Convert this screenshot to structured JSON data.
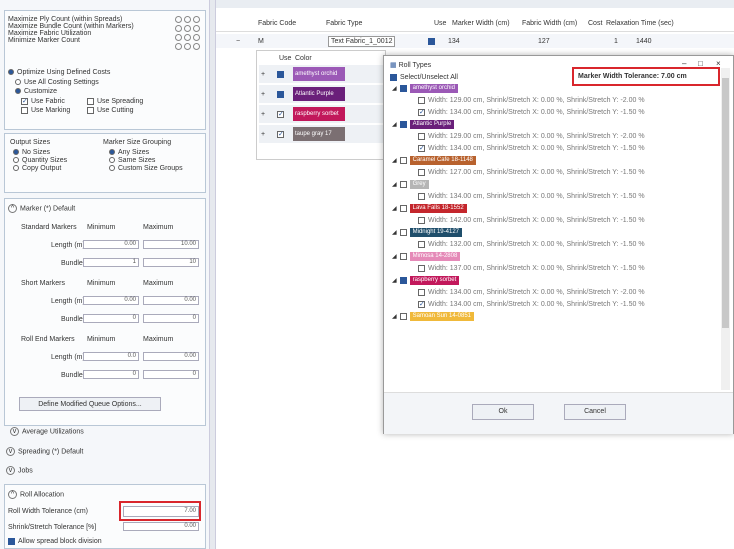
{
  "colors": {
    "accent": "#2b579a",
    "highlight_border": "#d9262c",
    "panel_border": "#b9c7d6"
  },
  "left": {
    "counts": [
      "Maximize Ply Count (within Spreads)",
      "Maximize Bundle Count (within Markers)",
      "Maximize Fabric Utilization",
      "Minimize Marker Count"
    ],
    "optimize": "Optimize Using Defined Costs",
    "use_all_costing": "Use All Costing Settings",
    "customize": "Customize",
    "use_fabric": "Use Fabric",
    "use_spreading": "Use Spreading",
    "use_marking": "Use Marking",
    "use_cutting": "Use Cutting",
    "output_sizes": "Output Sizes",
    "no_sizes": "No Sizes",
    "quantity_sizes": "Quantity Sizes",
    "copy_output": "Copy Output",
    "marker_grouping": "Marker Size Grouping",
    "any_sizes": "Any Sizes",
    "same_sizes": "Same Sizes",
    "custom_groups": "Custom Size Groups",
    "marker_header": "Marker (*) Default",
    "standard_markers": "Standard Markers",
    "minimum": "Minimum",
    "maximum": "Maximum",
    "length": "Length (m)",
    "bundles": "Bundles",
    "std_len_min": "0.00",
    "std_len_max": "10.00",
    "std_bun_min": "1",
    "std_bun_max": "10",
    "short_markers": "Short Markers",
    "short_len_min": "0.00",
    "short_len_max": "0.00",
    "short_bun_min": "0",
    "short_bun_max": "0",
    "roll_end": "Roll End Markers",
    "re_len_min": "0.0",
    "re_len_max": "0.00",
    "re_bun_min": "0",
    "re_bun_max": "0",
    "define_btn": "Define Modified Queue Options...",
    "avg_util": "Average Utilizations",
    "spreading": "Spreading (*) Default",
    "jobs": "Jobs",
    "roll_alloc": "Roll Allocation",
    "roll_width_tol": "Roll Width Tolerance (cm)",
    "roll_width_val": "7.00",
    "shrink_tol": "Shrink/Stretch Tolerance [%]",
    "shrink_val": "0.00",
    "allow_spread": "Allow spread block division"
  },
  "grid": {
    "headers": [
      "Fabric Code",
      "Fabric Type",
      "Use",
      "Marker Width (cm)",
      "Fabric Width (cm)",
      "Cost",
      "Relaxation Time (sec)"
    ],
    "row_code": "M",
    "row_type": "Text Fabric_1_0012",
    "row_width": "134",
    "row_fabric": "127",
    "row_cost": "1",
    "row_relax": "1440",
    "sub_headers": [
      "Use",
      "Color"
    ],
    "colors": [
      {
        "label": "amethyst orchid",
        "color": "#9b59b6"
      },
      {
        "label": "Atlantic Purple",
        "color": "#6a1f7a"
      },
      {
        "label": "raspberry sorbet",
        "color": "#c2185b"
      },
      {
        "label": "taupe gray 17",
        "color": "#7b6f72"
      }
    ]
  },
  "dialog": {
    "title": "Roll Types",
    "select_all": "Select/Unselect All",
    "tolerance": "Marker Width Tolerance: 7.00 cm",
    "ok": "Ok",
    "cancel": "Cancel",
    "groups": [
      {
        "label": "amethyst orchid",
        "color": "#9b59b6",
        "state": "on",
        "rows": [
          {
            "text": "Width: 129.00 cm, Shrink/Stretch X: 0.00 %, Shrink/Stretch Y: -2.00 %",
            "on": false
          },
          {
            "text": "Width: 134.00 cm, Shrink/Stretch X: 0.00 %, Shrink/Stretch Y: -1.50 %",
            "on": true
          }
        ]
      },
      {
        "label": "Atlantic Purple",
        "color": "#6a1f7a",
        "state": "on",
        "rows": [
          {
            "text": "Width: 129.00 cm, Shrink/Stretch X: 0.00 %, Shrink/Stretch Y: -2.00 %",
            "on": false
          },
          {
            "text": "Width: 134.00 cm, Shrink/Stretch X: 0.00 %, Shrink/Stretch Y: -1.50 %",
            "on": true
          }
        ]
      },
      {
        "label": "Caramel Cafe 18-1148",
        "color": "#b8622e",
        "state": "off",
        "rows": [
          {
            "text": "Width: 127.00 cm, Shrink/Stretch X: 0.00 %, Shrink/Stretch Y: -1.50 %",
            "on": false
          }
        ]
      },
      {
        "label": "Grey",
        "color": "#b5b5b5",
        "state": "off",
        "rows": [
          {
            "text": "Width: 134.00 cm, Shrink/Stretch X: 0.00 %, Shrink/Stretch Y: -1.50 %",
            "on": false
          }
        ]
      },
      {
        "label": "Lava Falls 18-1552",
        "color": "#c4262c",
        "state": "off",
        "rows": [
          {
            "text": "Width: 142.00 cm, Shrink/Stretch X: 0.00 %, Shrink/Stretch Y: -1.50 %",
            "on": false
          }
        ]
      },
      {
        "label": "Midnight 19-4127",
        "color": "#1f4e6b",
        "state": "off",
        "rows": [
          {
            "text": "Width: 132.00 cm, Shrink/Stretch X: 0.00 %, Shrink/Stretch Y: -1.50 %",
            "on": false
          }
        ]
      },
      {
        "label": "Mimosa 14-2808",
        "color": "#e58ab8",
        "state": "off",
        "rows": [
          {
            "text": "Width: 137.00 cm, Shrink/Stretch X: 0.00 %, Shrink/Stretch Y: -1.50 %",
            "on": false
          }
        ]
      },
      {
        "label": "raspberry sorbet",
        "color": "#c2185b",
        "state": "on",
        "rows": [
          {
            "text": "Width: 134.00 cm, Shrink/Stretch X: 0.00 %, Shrink/Stretch Y: -2.00 %",
            "on": false
          },
          {
            "text": "Width: 134.00 cm, Shrink/Stretch X: 0.00 %, Shrink/Stretch Y: -1.50 %",
            "on": true
          }
        ]
      },
      {
        "label": "Samoan Sun 14-0851",
        "color": "#f0b93a",
        "state": "off",
        "rows": []
      }
    ]
  }
}
